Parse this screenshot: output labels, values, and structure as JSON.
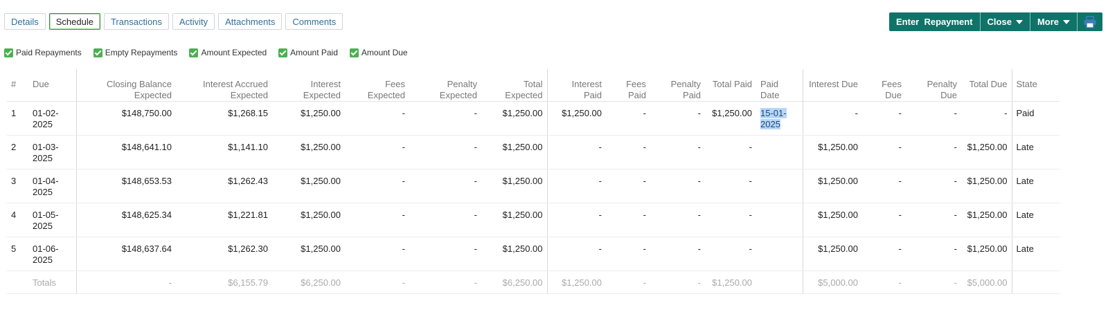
{
  "tabs": [
    {
      "label": "Details"
    },
    {
      "label": "Schedule"
    },
    {
      "label": "Transactions"
    },
    {
      "label": "Activity"
    },
    {
      "label": "Attachments"
    },
    {
      "label": "Comments"
    }
  ],
  "actions": {
    "enter_repayment": "Enter  Repayment",
    "close": "Close",
    "more": "More",
    "print_icon": "printer-icon"
  },
  "filters": [
    {
      "label": "Paid Repayments"
    },
    {
      "label": "Empty Repayments"
    },
    {
      "label": "Amount Expected"
    },
    {
      "label": "Amount Paid"
    },
    {
      "label": "Amount Due"
    }
  ],
  "colors": {
    "accent": "#0e7469",
    "checkbox": "#4caf50",
    "paid": "#2e7d32",
    "late": "#c62828"
  },
  "table": {
    "headers": {
      "num": "#",
      "due": "Due",
      "closing_balance": "Closing Balance Expected",
      "interest_accrued": "Interest Accrued Expected",
      "interest_expected": "Interest Expected",
      "fees_expected": "Fees Expected",
      "penalty_expected": "Penalty Expected",
      "total_expected": "Total Expected",
      "interest_paid": "Interest Paid",
      "fees_paid": "Fees Paid",
      "penalty_paid": "Penalty Paid",
      "total_paid": "Total Paid",
      "paid_date": "Paid Date",
      "interest_due": "Interest Due",
      "fees_due": "Fees Due",
      "penalty_due": "Penalty Due",
      "total_due": "Total Due",
      "state": "State"
    },
    "rows": [
      {
        "num": "1",
        "due": "01-02-2025",
        "closing_balance": "$148,750.00",
        "interest_accrued": "$1,268.15",
        "interest_expected": "$1,250.00",
        "fees_expected": "-",
        "penalty_expected": "-",
        "total_expected": "$1,250.00",
        "interest_paid": "$1,250.00",
        "fees_paid": "-",
        "penalty_paid": "-",
        "total_paid": "$1,250.00",
        "paid_date": "15-01-2025",
        "interest_due": "-",
        "fees_due": "-",
        "penalty_due": "-",
        "total_due": "-",
        "state": "Paid"
      },
      {
        "num": "2",
        "due": "01-03-2025",
        "closing_balance": "$148,641.10",
        "interest_accrued": "$1,141.10",
        "interest_expected": "$1,250.00",
        "fees_expected": "-",
        "penalty_expected": "-",
        "total_expected": "$1,250.00",
        "interest_paid": "-",
        "fees_paid": "-",
        "penalty_paid": "-",
        "total_paid": "-",
        "paid_date": "",
        "interest_due": "$1,250.00",
        "fees_due": "-",
        "penalty_due": "-",
        "total_due": "$1,250.00",
        "state": "Late"
      },
      {
        "num": "3",
        "due": "01-04-2025",
        "closing_balance": "$148,653.53",
        "interest_accrued": "$1,262.43",
        "interest_expected": "$1,250.00",
        "fees_expected": "-",
        "penalty_expected": "-",
        "total_expected": "$1,250.00",
        "interest_paid": "-",
        "fees_paid": "-",
        "penalty_paid": "-",
        "total_paid": "-",
        "paid_date": "",
        "interest_due": "$1,250.00",
        "fees_due": "-",
        "penalty_due": "-",
        "total_due": "$1,250.00",
        "state": "Late"
      },
      {
        "num": "4",
        "due": "01-05-2025",
        "closing_balance": "$148,625.34",
        "interest_accrued": "$1,221.81",
        "interest_expected": "$1,250.00",
        "fees_expected": "-",
        "penalty_expected": "-",
        "total_expected": "$1,250.00",
        "interest_paid": "-",
        "fees_paid": "-",
        "penalty_paid": "-",
        "total_paid": "-",
        "paid_date": "",
        "interest_due": "$1,250.00",
        "fees_due": "-",
        "penalty_due": "-",
        "total_due": "$1,250.00",
        "state": "Late"
      },
      {
        "num": "5",
        "due": "01-06-2025",
        "closing_balance": "$148,637.64",
        "interest_accrued": "$1,262.30",
        "interest_expected": "$1,250.00",
        "fees_expected": "-",
        "penalty_expected": "-",
        "total_expected": "$1,250.00",
        "interest_paid": "-",
        "fees_paid": "-",
        "penalty_paid": "-",
        "total_paid": "-",
        "paid_date": "",
        "interest_due": "$1,250.00",
        "fees_due": "-",
        "penalty_due": "-",
        "total_due": "$1,250.00",
        "state": "Late"
      }
    ],
    "totals": {
      "label": "Totals",
      "closing_balance": "-",
      "interest_accrued": "$6,155.79",
      "interest_expected": "$6,250.00",
      "fees_expected": "-",
      "penalty_expected": "-",
      "total_expected": "$6,250.00",
      "interest_paid": "$1,250.00",
      "fees_paid": "-",
      "penalty_paid": "-",
      "total_paid": "$1,250.00",
      "paid_date": "",
      "interest_due": "$5,000.00",
      "fees_due": "-",
      "penalty_due": "-",
      "total_due": "$5,000.00",
      "state": ""
    }
  }
}
